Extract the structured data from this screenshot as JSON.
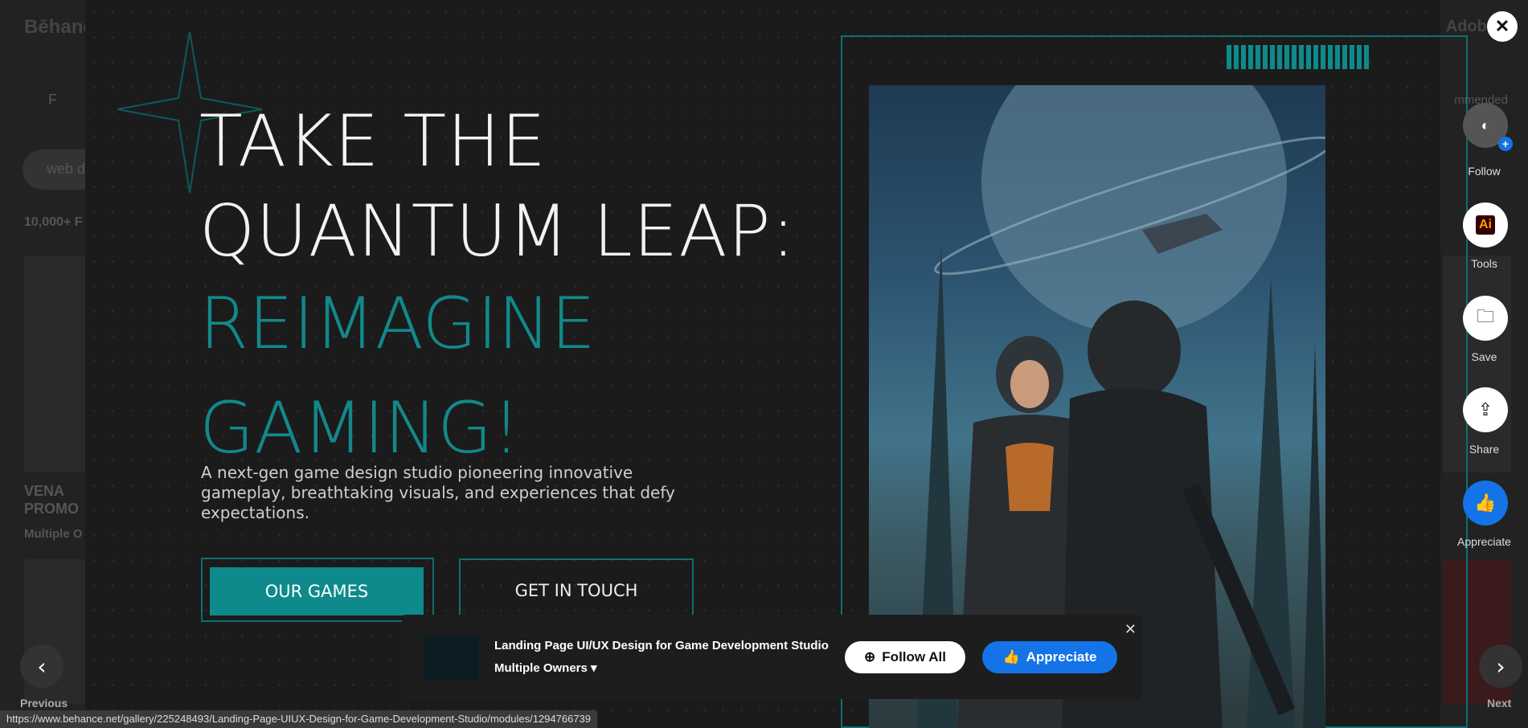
{
  "background": {
    "logo": "Bēhance",
    "adobe": "Adobe",
    "filter": "F",
    "sort": "mmended",
    "chip": "web d",
    "count": "10,000+ F",
    "card_title": "VENA PROMO",
    "card_owner": "Multiple O"
  },
  "hero": {
    "title_line1": "TAKE THE",
    "title_line2": "QUANTUM LEAP:",
    "accent_line1": "REIMAGINE",
    "accent_line2": "GAMING!",
    "subtitle": "A next-gen game design studio pioneering innovative gameplay, breathtaking visuals, and experiences that defy expectations.",
    "btn_games": "OUR GAMES",
    "btn_contact": "GET IN TOUCH",
    "accent_color": "#0e8a8c"
  },
  "rail": {
    "follow": "Follow",
    "tools": "Tools",
    "tools_icon": "Ai",
    "save": "Save",
    "share": "Share",
    "appreciate": "Appreciate"
  },
  "nav": {
    "previous": "Previous",
    "next": "Next"
  },
  "infobar": {
    "title": "Landing Page UI/UX Design for Game Development Studio",
    "owner": "Multiple Owners",
    "follow_all": "Follow All",
    "appreciate": "Appreciate"
  },
  "status_url": "https://www.behance.net/gallery/225248493/Landing-Page-UIUX-Design-for-Game-Development-Studio/modules/1294766739"
}
